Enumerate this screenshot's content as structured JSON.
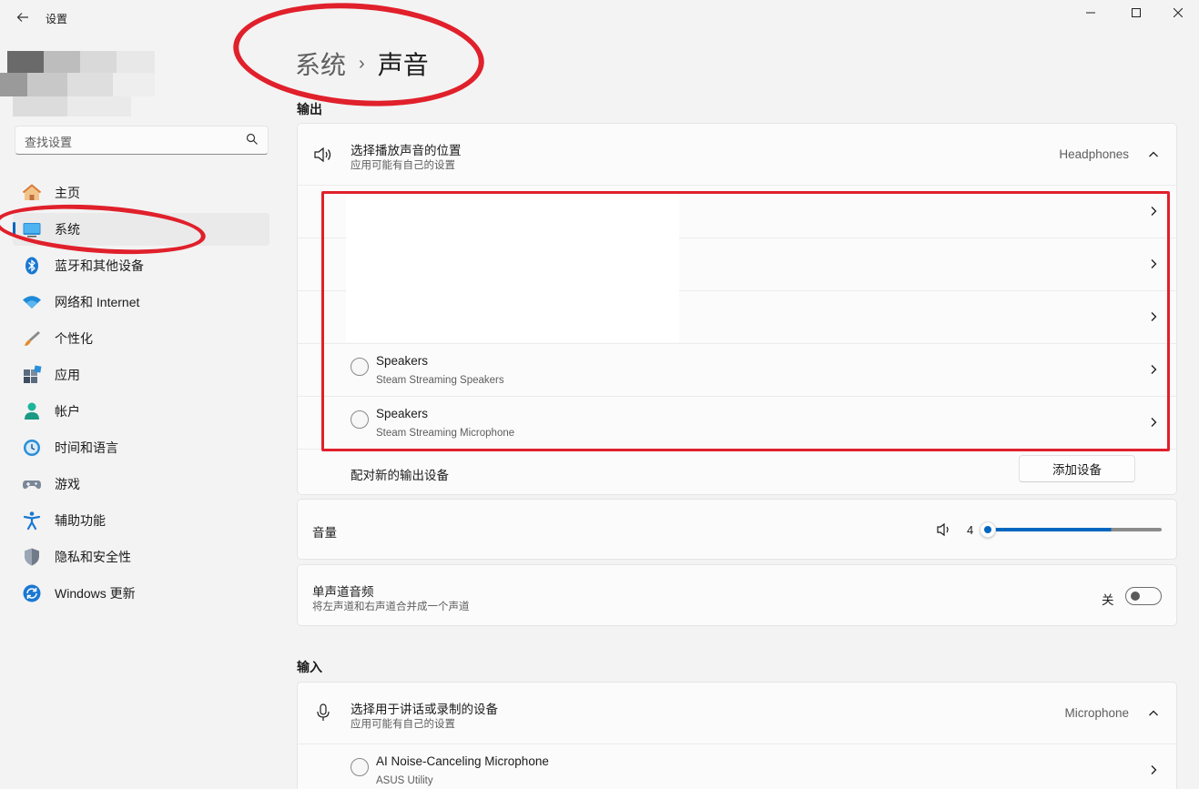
{
  "window": {
    "title": "设置"
  },
  "search": {
    "placeholder": "查找设置"
  },
  "sidebar": {
    "items": [
      {
        "label": "主页",
        "icon": "home-icon"
      },
      {
        "label": "系统",
        "icon": "system-icon",
        "active": true
      },
      {
        "label": "蓝牙和其他设备",
        "icon": "bluetooth-icon"
      },
      {
        "label": "网络和 Internet",
        "icon": "wifi-icon"
      },
      {
        "label": "个性化",
        "icon": "brush-icon"
      },
      {
        "label": "应用",
        "icon": "apps-icon"
      },
      {
        "label": "帐户",
        "icon": "account-icon"
      },
      {
        "label": "时间和语言",
        "icon": "clock-icon"
      },
      {
        "label": "游戏",
        "icon": "gamepad-icon"
      },
      {
        "label": "辅助功能",
        "icon": "accessibility-icon"
      },
      {
        "label": "隐私和安全性",
        "icon": "shield-icon"
      },
      {
        "label": "Windows 更新",
        "icon": "update-icon"
      }
    ]
  },
  "breadcrumb": {
    "parent": "系统",
    "separator": "›",
    "current": "声音"
  },
  "output": {
    "section_label": "输出",
    "chooser": {
      "title": "选择播放声音的位置",
      "subtitle": "应用可能有自己的设置",
      "selected": "Headphones"
    },
    "devices": [
      {
        "name": "Speakers",
        "detail": "Steam Streaming Speakers"
      },
      {
        "name": "Speakers",
        "detail": "Steam Streaming Microphone"
      }
    ],
    "pair": {
      "label": "配对新的输出设备",
      "button": "添加设备"
    },
    "volume": {
      "label": "音量",
      "value": "4",
      "level": 0.04
    },
    "mono": {
      "title": "单声道音频",
      "subtitle": "将左声道和右声道合并成一个声道",
      "state": "关"
    }
  },
  "input": {
    "section_label": "输入",
    "chooser": {
      "title": "选择用于讲话或录制的设备",
      "subtitle": "应用可能有自己的设置",
      "selected": "Microphone"
    },
    "devices": [
      {
        "name": "AI Noise-Canceling Microphone",
        "detail": "ASUS Utility"
      }
    ]
  },
  "colors": {
    "accent": "#0067c0",
    "annotation": "#e0202b"
  }
}
